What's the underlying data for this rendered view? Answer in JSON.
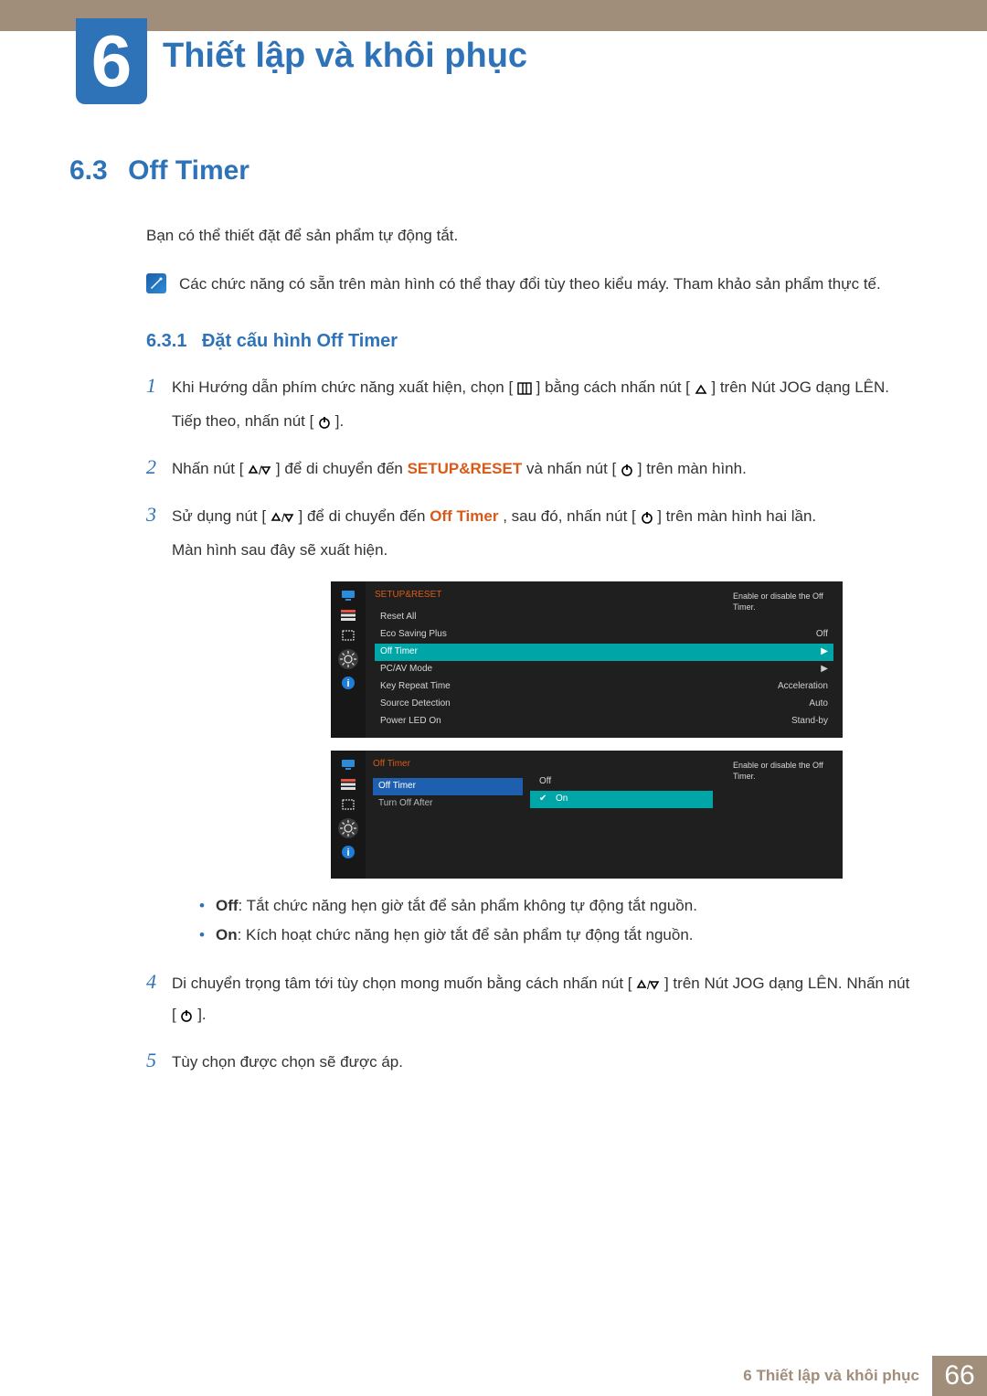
{
  "chapter": {
    "number": "6",
    "title": "Thiết lập và khôi phục"
  },
  "section": {
    "number": "6.3",
    "title": "Off Timer"
  },
  "intro": "Bạn có thể thiết đặt để sản phẩm tự động tắt.",
  "note": "Các chức năng có sẵn trên màn hình có thể thay đổi tùy theo kiểu máy. Tham khảo sản phẩm thực tế.",
  "subsection": {
    "number": "6.3.1",
    "title": "Đặt cấu hình Off Timer"
  },
  "steps": {
    "s1_a": "Khi Hướng dẫn phím chức năng xuất hiện, chọn [",
    "s1_b": "] bằng cách nhấn nút [",
    "s1_c": "] trên Nút JOG dạng LÊN.",
    "s1_d": "Tiếp theo, nhấn nút [",
    "s1_e": "].",
    "s2_a": "Nhấn nút [",
    "s2_b": "] để di chuyển đến ",
    "s2_setup": "SETUP&RESET",
    "s2_c": " và nhấn nút [",
    "s2_d": "] trên màn hình.",
    "s3_a": "Sử dụng nút [",
    "s3_b": "] để di chuyển đến ",
    "s3_off": "Off Timer",
    "s3_c": ", sau đó, nhấn nút [",
    "s3_d": "] trên màn hình hai lần.",
    "s3_e": "Màn hình sau đây sẽ xuất hiện.",
    "bul_off_lbl": "Off",
    "bul_off_txt": ": Tắt chức năng hẹn giờ tắt để sản phẩm không tự động tắt nguồn.",
    "bul_on_lbl": "On",
    "bul_on_txt": ": Kích hoạt chức năng hẹn giờ tắt để sản phẩm tự động tắt nguồn.",
    "s4_a": "Di chuyển trọng tâm tới tùy chọn mong muốn bằng cách nhấn nút [",
    "s4_b": "] trên Nút JOG dạng LÊN. Nhấn nút [",
    "s4_c": "].",
    "s5": "Tùy chọn được chọn sẽ được áp."
  },
  "osd1": {
    "title": "SETUP&RESET",
    "rows": [
      {
        "label": "Reset All",
        "value": ""
      },
      {
        "label": "Eco Saving Plus",
        "value": "Off"
      },
      {
        "label": "Off Timer",
        "value": "▶",
        "selected": true
      },
      {
        "label": "PC/AV Mode",
        "value": "▶"
      },
      {
        "label": "Key Repeat Time",
        "value": "Acceleration"
      },
      {
        "label": "Source Detection",
        "value": "Auto"
      },
      {
        "label": "Power LED On",
        "value": "Stand-by"
      }
    ],
    "tip": "Enable or disable the Off Timer."
  },
  "osd2": {
    "title": "Off Timer",
    "left": [
      {
        "label": "Off Timer",
        "selected": true
      },
      {
        "label": "Turn Off After",
        "selected": false
      }
    ],
    "right": [
      {
        "label": "Off",
        "selected": false
      },
      {
        "label": "On",
        "selected": true
      }
    ],
    "tip": "Enable or disable the Off Timer."
  },
  "footer": {
    "label": "6 Thiết lập và khôi phục",
    "page": "66"
  }
}
